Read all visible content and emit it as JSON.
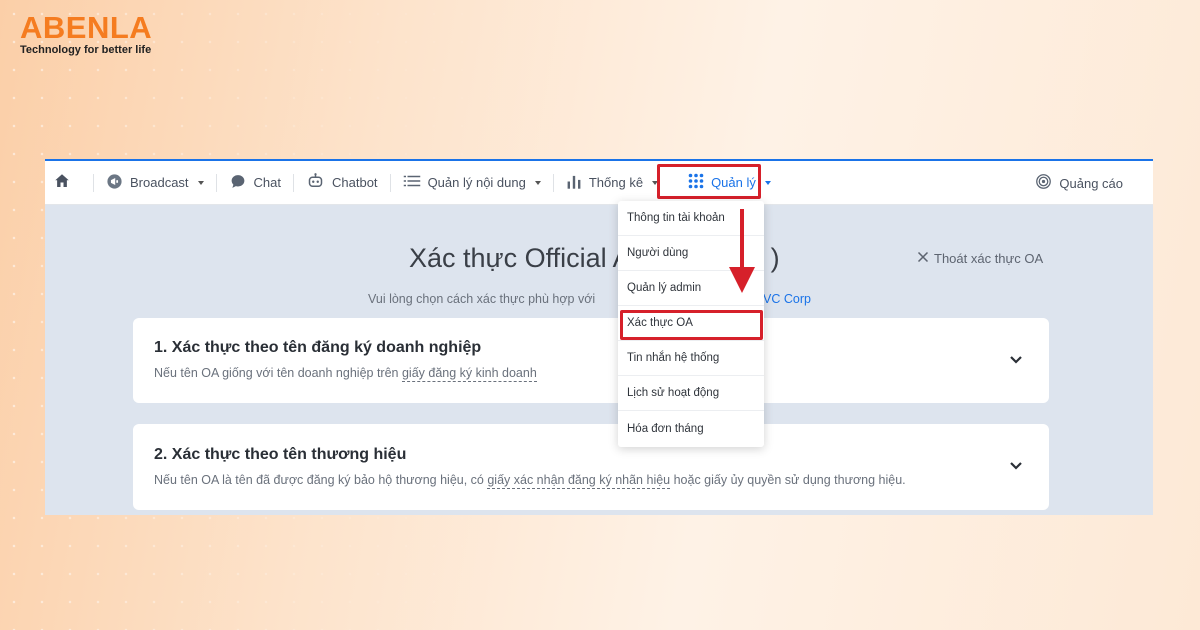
{
  "brand": {
    "name": "ABENLA",
    "tagline": "Technology for better life",
    "color": "#f57c20"
  },
  "navbar": {
    "home_icon": "home-icon",
    "items": [
      {
        "label": "Broadcast",
        "icon": "megaphone-icon"
      },
      {
        "label": "Chat",
        "icon": "chat-icon"
      },
      {
        "label": "Chatbot",
        "icon": "bot-icon"
      },
      {
        "label": "Quản lý nội dung",
        "icon": "list-icon"
      },
      {
        "label": "Thống kê",
        "icon": "bar-chart-icon"
      },
      {
        "label": "Quản lý",
        "icon": "grid-icon"
      }
    ],
    "right_item": {
      "label": "Quảng cáo",
      "icon": "target-icon"
    }
  },
  "page": {
    "title": "Xác thực Official A",
    "title_tail": ")",
    "exit_label": "Thoát xác thực OA",
    "subtitle": "Vui lòng chọn cách xác thực phù hợp với",
    "subtitle_link": "VC Corp"
  },
  "cards": [
    {
      "title": "1. Xác thực theo tên đăng ký doanh nghiệp",
      "desc_prefix": "Nếu tên OA giống với tên doanh nghiệp trên ",
      "desc_link": "giấy đăng ký kinh doanh",
      "desc_suffix": ""
    },
    {
      "title": "2. Xác thực theo tên thương hiệu",
      "desc_prefix": "Nếu tên OA là tên đã được đăng ký bảo hộ thương hiệu, có ",
      "desc_link": "giấy xác nhận đăng ký nhãn hiệu",
      "desc_suffix": " hoặc giấy ủy quyền sử dụng thương hiệu."
    }
  ],
  "dropdown": {
    "items": [
      "Thông tin tài khoản",
      "Người dùng",
      "Quản lý admin",
      "Xác thực OA",
      "Tin nhắn hệ thống",
      "Lịch sử hoạt động",
      "Hóa đơn tháng"
    ],
    "highlighted_index": 3
  },
  "colors": {
    "accent": "#1a73e8",
    "highlight": "#d6202a"
  }
}
